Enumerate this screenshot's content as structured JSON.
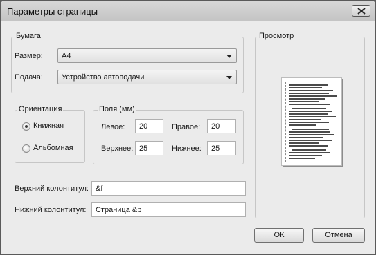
{
  "window": {
    "title": "Параметры страницы"
  },
  "paper": {
    "legend": "Бумага",
    "size_label": "Размер:",
    "size_value": "A4",
    "source_label": "Подача:",
    "source_value": "Устройство автоподачи"
  },
  "orientation": {
    "legend": "Ориентация",
    "portrait_label": "Книжная",
    "landscape_label": "Альбомная",
    "selected": "portrait"
  },
  "margins": {
    "legend": "Поля (мм)",
    "left_label": "Левое:",
    "left_value": "20",
    "right_label": "Правое:",
    "right_value": "20",
    "top_label": "Верхнее:",
    "top_value": "25",
    "bottom_label": "Нижнее:",
    "bottom_value": "25"
  },
  "header": {
    "label": "Верхний колонтитул:",
    "value": "&f"
  },
  "footer": {
    "label": "Нижний колонтитул:",
    "value": "Страница &p"
  },
  "preview": {
    "legend": "Просмотр"
  },
  "buttons": {
    "ok": "ОК",
    "cancel": "Отмена"
  },
  "icons": {
    "close": "close-icon",
    "dropdown": "chevron-down-icon"
  }
}
